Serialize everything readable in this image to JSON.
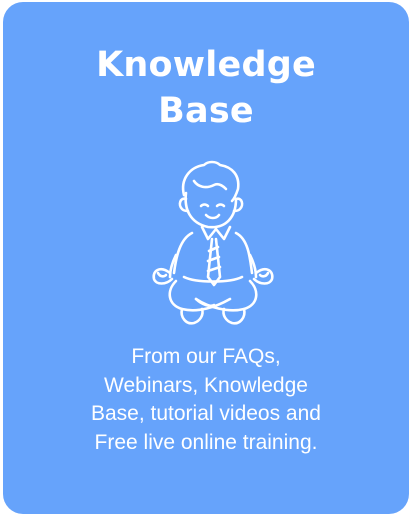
{
  "card": {
    "title_line1": "Knowledge",
    "title_line2": "Base",
    "illustration": "meditating-person-icon",
    "description_lines": [
      "From our FAQs,",
      "Webinars, Knowledge",
      "Base, tutorial videos and",
      "Free live online training."
    ],
    "background_color": "#66a3fb",
    "text_color": "#ffffff"
  }
}
